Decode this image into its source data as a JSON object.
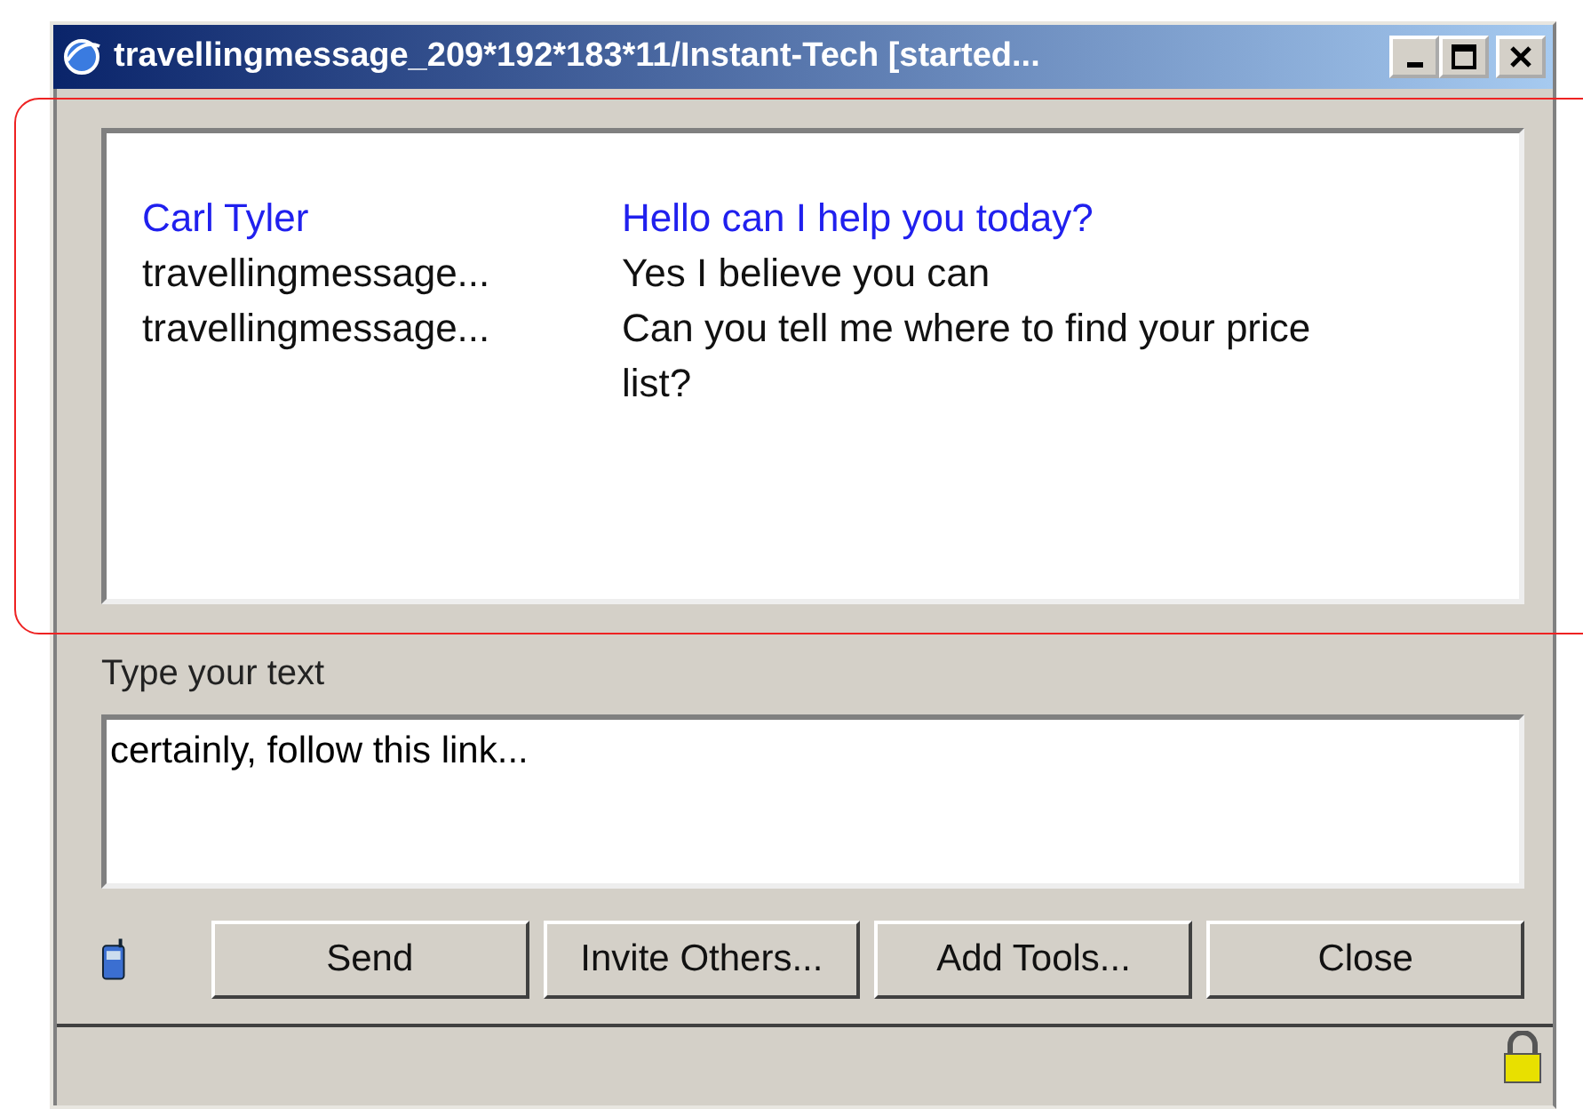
{
  "window": {
    "title": "travellingmessage_209*192*183*11/Instant-Tech [started..."
  },
  "transcript": [
    {
      "sender": "Carl Tyler",
      "text": "Hello can I help you today?",
      "kind": "agent"
    },
    {
      "sender": "travellingmessage...",
      "text": "Yes I believe you can",
      "kind": "visitor"
    },
    {
      "sender": "travellingmessage...",
      "text": "Can you tell me where to find your price list?",
      "kind": "visitor"
    }
  ],
  "compose": {
    "label": "Type your text",
    "value": "certainly, follow this link..."
  },
  "buttons": [
    "Send",
    "Invite Others...",
    "Add Tools...",
    "Close"
  ],
  "annotation": {
    "highlighted": true
  }
}
